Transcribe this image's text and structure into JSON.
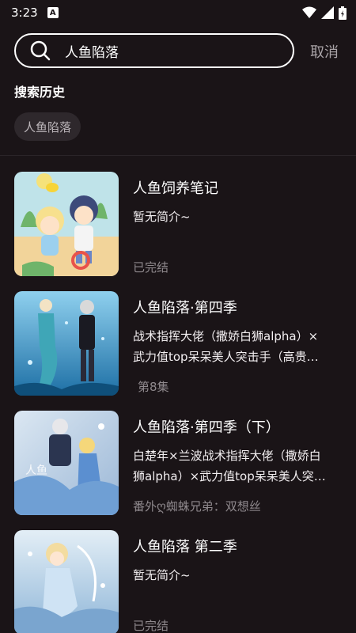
{
  "status_bar": {
    "time": "3:23",
    "notification_badge": "A"
  },
  "search": {
    "query": "人鱼陷落",
    "cancel_label": "取消"
  },
  "history": {
    "title": "搜索历史",
    "items": [
      "人鱼陷落"
    ]
  },
  "results": [
    {
      "title": "人鱼饲养笔记",
      "desc_line1": "暂无简介~",
      "desc_line2": "",
      "meta": "已完结",
      "cover_icon": "cartoon-cover"
    },
    {
      "title": "人鱼陷落·第四季",
      "desc_line1": "战术指挥大佬（撒娇白狮alpha）×",
      "desc_line2": "武力值top呆呆美人突击手（高贵…",
      "meta": "第8集",
      "cover_icon": "mermaid-cover"
    },
    {
      "title": "人鱼陷落·第四季（下）",
      "desc_line1": "白楚年×兰波战术指挥大佬（撒娇白",
      "desc_line2": "狮alpha）×武力值top呆呆美人突…",
      "meta": "番外ღ蜘蛛兄弟：双想丝",
      "cover_icon": "mermaid-cover"
    },
    {
      "title": "人鱼陷落 第二季",
      "desc_line1": "暂无简介~",
      "desc_line2": "",
      "meta": "已完结",
      "cover_icon": "mermaid-cover"
    }
  ],
  "colors": {
    "background": "#1a1417",
    "chip": "#2e282c",
    "muted": "#8f898d"
  }
}
